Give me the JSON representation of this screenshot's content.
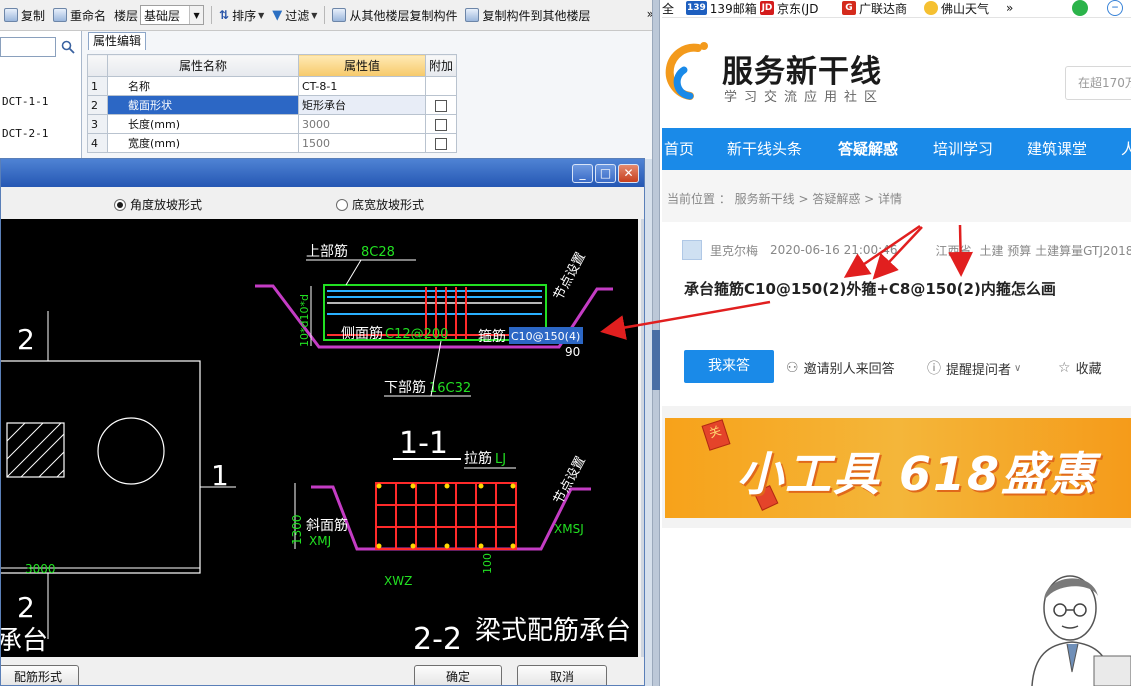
{
  "toolbar": {
    "copy": "复制",
    "rename": "重命名",
    "floor_label": "楼层",
    "floor_value": "基础层",
    "sort": "排序",
    "filter": "过滤",
    "copy_from": "从其他楼层复制构件",
    "copy_to": "复制构件到其他楼层",
    "more": "»"
  },
  "tree": {
    "items": [
      "DCT-1-1",
      "DCT-2-1"
    ]
  },
  "props": {
    "tab": "属性编辑",
    "headers": {
      "name": "属性名称",
      "value": "属性值",
      "extra": "附加"
    },
    "rows": [
      {
        "num": "1",
        "name": "名称",
        "value": "CT-8-1",
        "checkbox": false,
        "selected": false,
        "muted": false
      },
      {
        "num": "2",
        "name": "截面形状",
        "value": "矩形承台",
        "checkbox": true,
        "selected": true,
        "muted": false
      },
      {
        "num": "3",
        "name": "长度(mm)",
        "value": "3000",
        "checkbox": true,
        "selected": false,
        "muted": true
      },
      {
        "num": "4",
        "name": "宽度(mm)",
        "value": "1500",
        "checkbox": true,
        "selected": false,
        "muted": true
      }
    ]
  },
  "dialog": {
    "radio1": "角度放坡形式",
    "radio2": "底宽放坡形式",
    "btn_config": "配筋形式",
    "btn_ok": "确定",
    "btn_cancel": "取消",
    "win_min": "_",
    "win_max": "□",
    "win_close": "✕"
  },
  "cad": {
    "top_rebar": "上部筋",
    "top_rebar_val": "8C28",
    "side_rebar": "侧面筋",
    "side_rebar_val": "C12@200",
    "stirrup": "箍筋",
    "stirrup_val": "C10@150(4)",
    "bottom_rebar": "下部筋",
    "bottom_rebar_val": "16C32",
    "node_setting": "节点设置",
    "angle": "90",
    "height_dim": "10*d10*d",
    "section1": "1-1",
    "section2": "2-2",
    "tie": "拉筋",
    "tie_val": "LJ",
    "slope_rebar": "斜面筋",
    "slope_val": "XMJ",
    "xmsj": "XMSJ",
    "xwz": "XWZ",
    "dim_1300": "1300",
    "dim_100": "100",
    "dim_3000": "3000",
    "plan_mark_top": "2",
    "plan_mark_bottom": "2",
    "plan_mark_side": "1",
    "title": "梁式配筋承台",
    "left_title": "承台"
  },
  "bookmarks": [
    {
      "label": "全",
      "icon": ""
    },
    {
      "label": "139邮箱",
      "icon": "139"
    },
    {
      "label": "京东(JD",
      "icon": "JD"
    },
    {
      "label": "广联达商",
      "icon": "G"
    },
    {
      "label": "佛山天气",
      "icon": ""
    },
    {
      "label": "»",
      "icon": ""
    }
  ],
  "site": {
    "brand": "服务新干线",
    "slogan": "学习交流应用社区",
    "search_placeholder": "在超170万",
    "nav": [
      "首页",
      "新干线头条",
      "答疑解惑",
      "培训学习",
      "建筑课堂",
      "人"
    ],
    "breadcrumb": "当前位置 ： 服务新干线 > 答疑解惑 > 详情",
    "author": "里克尔梅",
    "datetime": "2020-06-16 21:00:46",
    "location": "江西省",
    "tags": "土建 预算 土建算量GTJ2018",
    "question": "承台箍筋C10@150(2)外箍+C8@150(2)内箍怎么画",
    "answer_btn": "我来答",
    "invite": "邀请别人来回答",
    "remind": "提醒提问者",
    "collect": "收藏",
    "banner_text": "小工具 618盛惠",
    "envelope": "关"
  },
  "colors": {
    "accent_blue": "#1a8ae8",
    "arrow_red": "#e11f1f",
    "cad_green": "#22e022",
    "cad_red": "#e01818"
  }
}
